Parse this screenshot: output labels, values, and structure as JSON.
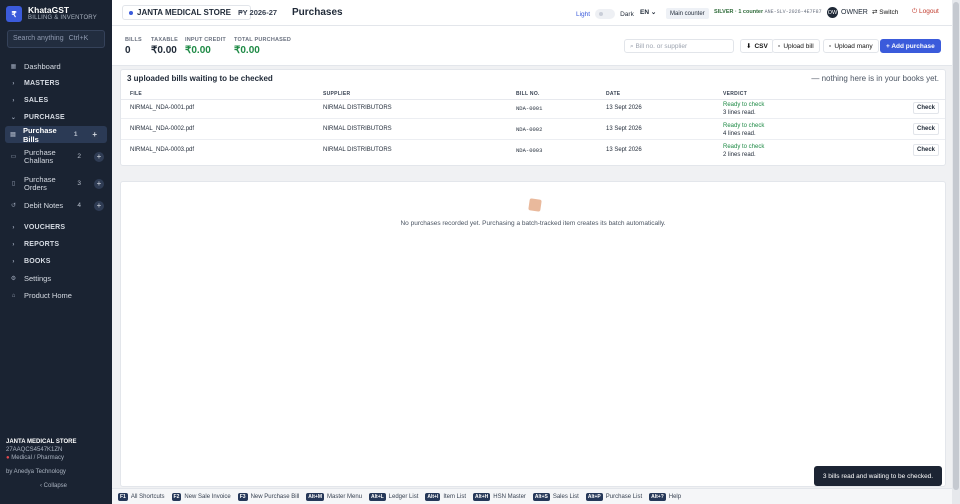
{
  "brand": {
    "logo": "₹",
    "name": "KhataGST",
    "sub": "BILLING & INVENTORY"
  },
  "search": {
    "placeholder": "Search anything",
    "shortcut": "Ctrl+K"
  },
  "nav": {
    "dashboard": "Dashboard",
    "masters": "MASTERS",
    "sales": "SALES",
    "purchase": "PURCHASE",
    "purchase_bills": {
      "label": "Purchase Bills",
      "count": "1"
    },
    "purchase_challans": {
      "label": "Purchase Challans",
      "count": "2"
    },
    "purchase_orders": {
      "label": "Purchase Orders",
      "count": "3"
    },
    "debit_notes": {
      "label": "Debit Notes",
      "count": "4"
    },
    "vouchers": "VOUCHERS",
    "reports": "REPORTS",
    "books": "BOOKS",
    "settings": "Settings",
    "product_home": "Product Home"
  },
  "footer": {
    "store": "JANTA MEDICAL STORE",
    "gstin": "27AAQCS4547K1ZN",
    "type": "Medical / Pharmacy",
    "by": "by Anedya Technology",
    "collapse": "‹ Collapse"
  },
  "topbar": {
    "store": "JANTA MEDICAL STORE",
    "fy": "FY 2026-27",
    "title": "Purchases",
    "light": "Light",
    "dark": "Dark",
    "lang": "EN",
    "counter": "Main counter",
    "tier": "SILVER · 1 counter",
    "tier_code": "ANE-SLV-2026-4E7F87",
    "avatar": "OW",
    "owner": "OWNER",
    "switch": "Switch",
    "logout": "Logout"
  },
  "stats": {
    "bills_label": "BILLS",
    "bills": "0",
    "taxable_label": "TAXABLE",
    "taxable": "₹0.00",
    "itc_label": "INPUT CREDIT",
    "itc": "₹0.00",
    "total_label": "TOTAL PURCHASED",
    "total": "₹0.00"
  },
  "actions": {
    "search_placeholder": "Bill no. or supplier",
    "csv": "CSV",
    "upload_bill": "Upload bill",
    "upload_many": "Upload many",
    "add_purchase": "+ Add purchase"
  },
  "uploads": {
    "title": "3 uploaded bills waiting to be checked",
    "nothing": "— nothing here is in your books yet.",
    "columns": {
      "file": "FILE",
      "supplier": "SUPPLIER",
      "bill_no": "BILL NO.",
      "date": "DATE",
      "verdict": "VERDICT"
    },
    "rows": [
      {
        "file": "NIRMAL_NDA-0001.pdf",
        "supplier": "NIRMAL DISTRIBUTORS",
        "bill_no": "NDA-0001",
        "date": "13 Sept 2026",
        "status": "Ready to check",
        "lines": "3 lines read.",
        "action": "Check"
      },
      {
        "file": "NIRMAL_NDA-0002.pdf",
        "supplier": "NIRMAL DISTRIBUTORS",
        "bill_no": "NDA-0002",
        "date": "13 Sept 2026",
        "status": "Ready to check",
        "lines": "4 lines read.",
        "action": "Check"
      },
      {
        "file": "NIRMAL_NDA-0003.pdf",
        "supplier": "NIRMAL DISTRIBUTORS",
        "bill_no": "NDA-0003",
        "date": "13 Sept 2026",
        "status": "Ready to check",
        "lines": "2 lines read.",
        "action": "Check"
      }
    ]
  },
  "empty": {
    "icon": "box-icon",
    "text": "No purchases recorded yet. Purchasing a batch-tracked item creates its batch automatically."
  },
  "shortcuts": [
    {
      "key": "F1",
      "label": "All Shortcuts"
    },
    {
      "key": "F2",
      "label": "New Sale Invoice"
    },
    {
      "key": "F3",
      "label": "New Purchase Bill"
    },
    {
      "key": "Alt+M",
      "label": "Master Menu"
    },
    {
      "key": "Alt+L",
      "label": "Ledger List"
    },
    {
      "key": "Alt+I",
      "label": "Item List"
    },
    {
      "key": "Alt+H",
      "label": "HSN Master"
    },
    {
      "key": "Alt+S",
      "label": "Sales List"
    },
    {
      "key": "Alt+P",
      "label": "Purchase List"
    },
    {
      "key": "Alt+?",
      "label": "Help"
    }
  ],
  "toast": "3 bills read and waiting to be checked."
}
